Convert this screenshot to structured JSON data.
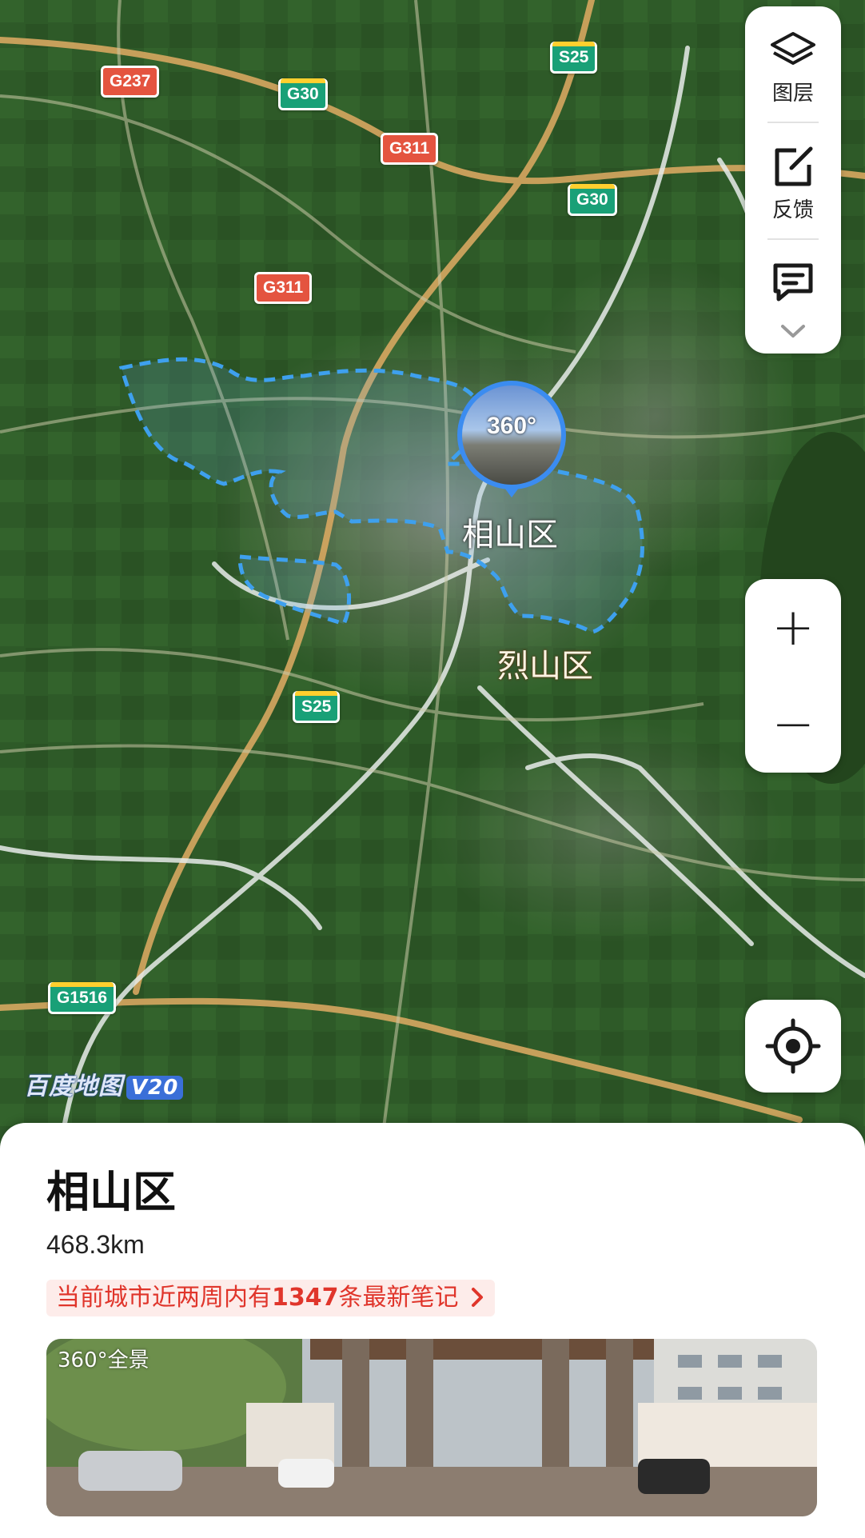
{
  "map": {
    "road_shields": [
      {
        "id": "g237",
        "label": "G237",
        "style": "red"
      },
      {
        "id": "g30a",
        "label": "G30",
        "style": "green"
      },
      {
        "id": "s25a",
        "label": "S25",
        "style": "green"
      },
      {
        "id": "g311a",
        "label": "G311",
        "style": "red"
      },
      {
        "id": "g30b",
        "label": "G30",
        "style": "green"
      },
      {
        "id": "g311b",
        "label": "G311",
        "style": "red"
      },
      {
        "id": "s25b",
        "label": "S25",
        "style": "green"
      },
      {
        "id": "g1516",
        "label": "G1516",
        "style": "green"
      }
    ],
    "districts": {
      "xiangshan": "相山区",
      "lieshan": "烈山区"
    },
    "panorama_marker": {
      "label": "360°"
    },
    "watermark": {
      "brand": "百度地图",
      "version": "V20"
    }
  },
  "toolbar": {
    "layers_label": "图层",
    "feedback_label": "反馈",
    "more_icon": "chevron-down-icon"
  },
  "zoom": {
    "in_label": "+",
    "out_label": "−"
  },
  "sheet": {
    "title": "相山区",
    "area": "468.3km",
    "notes_prefix": "当前城市近两周内有",
    "notes_count": "1347",
    "notes_suffix": "条最新笔记",
    "photo_tag": "360°全景"
  },
  "colors": {
    "accent_red": "#e0352b",
    "highway_red": "#e4543f",
    "highway_green": "#19a077",
    "boundary_blue": "#3ea0ee"
  }
}
